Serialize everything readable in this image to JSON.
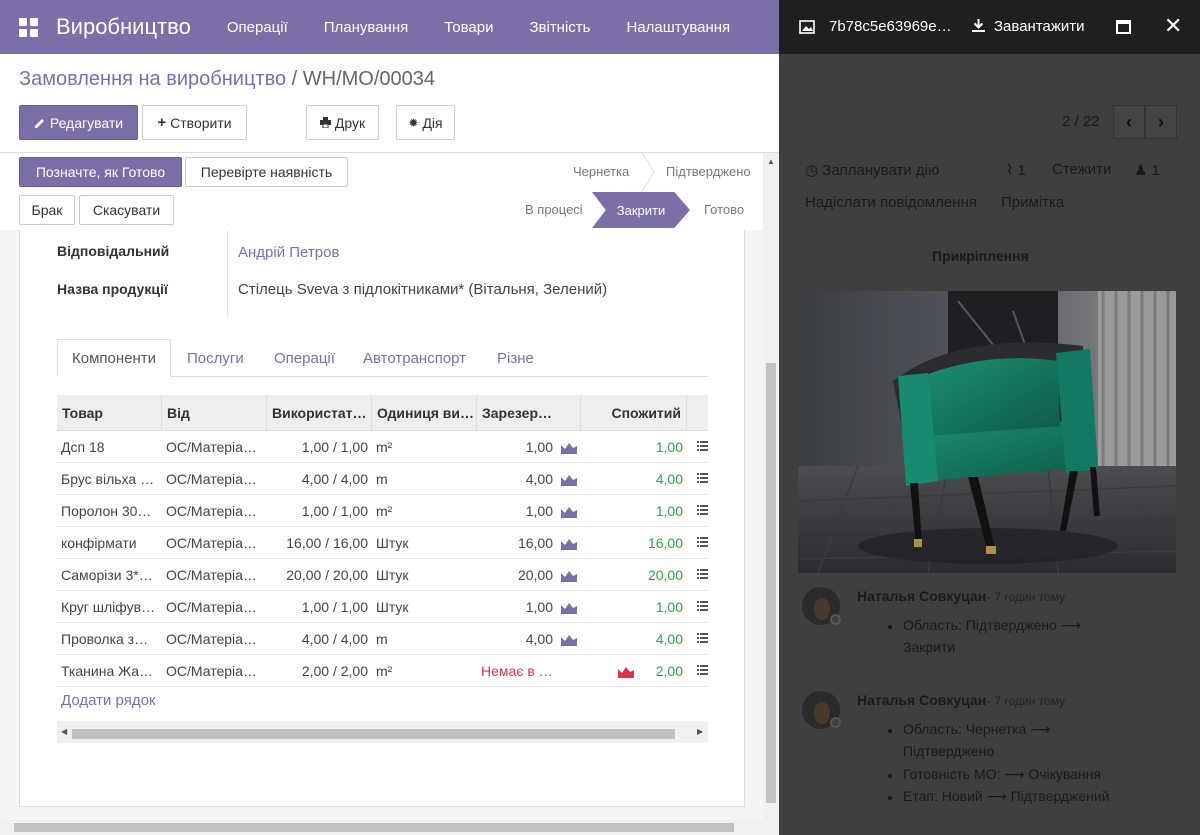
{
  "navbar": {
    "brand": "Виробництво",
    "menu": [
      "Операції",
      "Планування",
      "Товари",
      "Звітність",
      "Налаштування"
    ]
  },
  "breadcrumb": {
    "parent": "Замовлення на виробництво",
    "separator": " / ",
    "current": "WH/MO/00034"
  },
  "toolbar": {
    "edit": "Редагувати",
    "create": "Створити",
    "print": "Друк",
    "action": "Дія"
  },
  "statusbar": {
    "mark_done": "Позначте, як Готово",
    "check_availability": "Перевірте наявність",
    "scrap": "Брак",
    "cancel": "Скасувати",
    "stages_top": [
      "Чернетка",
      "Підтверджено"
    ],
    "stages_bottom": [
      "В процесі",
      "Закрити",
      "Готово"
    ],
    "active_stage": "Закрити"
  },
  "form": {
    "responsible_label": "Відповідальний",
    "responsible_value": "Андрій Петров",
    "product_label": "Назва продукції",
    "product_value": "Стілець Sveva з підлокітниками* (Вітальня, Зелений)"
  },
  "tabs": [
    "Компоненти",
    "Послуги",
    "Операції",
    "Автотранспорт",
    "Різне"
  ],
  "table": {
    "headers": [
      "Товар",
      "Від",
      "Використат…",
      "Одиниця ви…",
      "Зарезер…",
      "Спожитий"
    ],
    "rows": [
      {
        "product": "Дсп 18",
        "from": "OC/Матеріа…",
        "used": "1,00 / 1,00",
        "uom": "m²",
        "reserved": "1,00",
        "consumed": "1,00"
      },
      {
        "product": "Брус вільха …",
        "from": "OC/Матеріа…",
        "used": "4,00 / 4,00",
        "uom": "m",
        "reserved": "4,00",
        "consumed": "4,00"
      },
      {
        "product": "Поролон 30…",
        "from": "OC/Матеріа…",
        "used": "1,00 / 1,00",
        "uom": "m²",
        "reserved": "1,00",
        "consumed": "1,00"
      },
      {
        "product": "конфірмати",
        "from": "OC/Матеріа…",
        "used": "16,00 / 16,00",
        "uom": "Штук",
        "reserved": "16,00",
        "consumed": "16,00"
      },
      {
        "product": "Саморізи 3*…",
        "from": "OC/Матеріа…",
        "used": "20,00 / 20,00",
        "uom": "Штук",
        "reserved": "20,00",
        "consumed": "20,00"
      },
      {
        "product": "Круг шліфув…",
        "from": "OC/Матеріа…",
        "used": "1,00 / 1,00",
        "uom": "Штук",
        "reserved": "1,00",
        "consumed": "1,00"
      },
      {
        "product": "Проволка з…",
        "from": "OC/Матеріа…",
        "used": "4,00 / 4,00",
        "uom": "m",
        "reserved": "4,00",
        "consumed": "4,00"
      },
      {
        "product": "Тканина Жа…",
        "from": "OC/Матеріа…",
        "used": "2,00 / 2,00",
        "uom": "m²",
        "reserved": "Немає в …",
        "consumed": "2,00"
      }
    ],
    "add_line": "Додати рядок"
  },
  "viewer": {
    "filename": "7b78c5e63969e…",
    "download": "Завантажити",
    "pager": "2 / 22"
  },
  "chatter": {
    "schedule": "Запланувати дію",
    "attachments_count": "1",
    "follow": "Стежити",
    "followers_count": "1",
    "send_message": "Надіслати повідомлення",
    "note": "Примітка",
    "attachments_title": "Прикріплення",
    "messages": [
      {
        "author": "Наталья Совкуцан",
        "time": "- 7 годин тому",
        "lines": [
          "Область: Підтверджено ⟶",
          "Закрити"
        ]
      },
      {
        "author": "Наталья Совкуцан",
        "time": "- 7 годин тому",
        "lines": [
          "Область: Чернетка ⟶",
          "Підтверджено",
          "Готовність МО: ⟶ Очікування",
          "Етап: Новий ⟶ Підтверджений"
        ]
      }
    ]
  },
  "colors": {
    "brand": "#7c6fa8",
    "green": "#28a745",
    "red": "#dc3545",
    "overlay": "#3f3f3f"
  }
}
